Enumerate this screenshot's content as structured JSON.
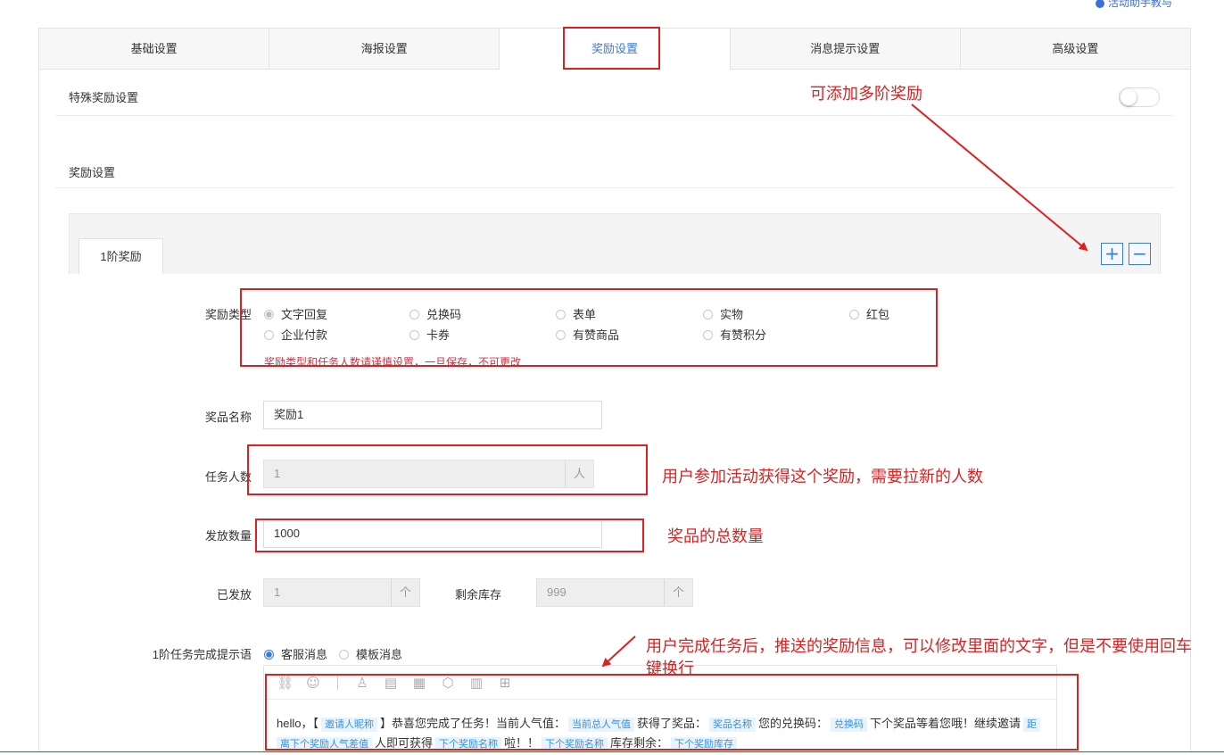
{
  "header": {
    "help_link": "活动助手教与"
  },
  "tabs": [
    {
      "label": "基础设置"
    },
    {
      "label": "海报设置"
    },
    {
      "label": "奖励设置"
    },
    {
      "label": "消息提示设置"
    },
    {
      "label": "高级设置"
    }
  ],
  "special_reward": {
    "label": "特殊奖励设置",
    "enabled": false
  },
  "reward_settings": {
    "label": "奖励设置"
  },
  "tier": {
    "tab_label": "1阶奖励",
    "add_symbol": "+",
    "remove_symbol": "−"
  },
  "form": {
    "reward_type": {
      "label": "奖励类型",
      "options": [
        "文字回复",
        "兑换码",
        "表单",
        "实物",
        "红包",
        "企业付款",
        "卡券",
        "有赞商品",
        "有赞积分"
      ],
      "selected": "文字回复",
      "warning": "奖励类型和任务人数请谨慎设置，一旦保存，不可更改"
    },
    "prize_name": {
      "label": "奖品名称",
      "value": "奖励1"
    },
    "task_count": {
      "label": "任务人数",
      "value": "1",
      "unit": "人"
    },
    "issue_count": {
      "label": "发放数量",
      "value": "1000"
    },
    "issued": {
      "label": "已发放",
      "value": "1",
      "unit": "个"
    },
    "remaining": {
      "label": "剩余库存",
      "value": "999",
      "unit": "个"
    },
    "completion_msg": {
      "label": "1阶任务完成提示语",
      "options": [
        "客服消息",
        "模板消息"
      ],
      "selected": "客服消息"
    }
  },
  "editor": {
    "tools": [
      "link-icon",
      "emoji-icon",
      "user-icon",
      "doc-icon",
      "db-icon",
      "box-icon",
      "chart-icon",
      "gift-icon"
    ],
    "message": {
      "p1": "hello，【",
      "t1": "邀请人昵称",
      "p2": "】恭喜您完成了任务！当前人气值：",
      "t2": "当前总人气值",
      "p3": "获得了奖品：",
      "t3": "奖品名称",
      "p4": "您的兑换码：",
      "t4": "兑换码",
      "p5": "下个奖品等着您哦！继续邀请",
      "t5a": "距",
      "t5b": "离下个奖励人气差值",
      "p6": "人即可获得",
      "t6": "下个奖励名称",
      "p7": "啦！！",
      "t7": "下个奖励名称",
      "p8": "库存剩余：",
      "t8": "下个奖励库存"
    }
  },
  "annotations": {
    "multi_tier": "可添加多阶奖励",
    "task_count": "用户参加活动获得这个奖励，需要拉新的人数",
    "total": "奖品的总数量",
    "message_line1": "用户完成任务后，推送的奖励信息，可以修改里面的文字，但是不要使用回车",
    "message_line2": "键换行"
  },
  "colors": {
    "accent": "#3a7bd5",
    "annotation": "#e02020",
    "warning": "#cc3344"
  }
}
